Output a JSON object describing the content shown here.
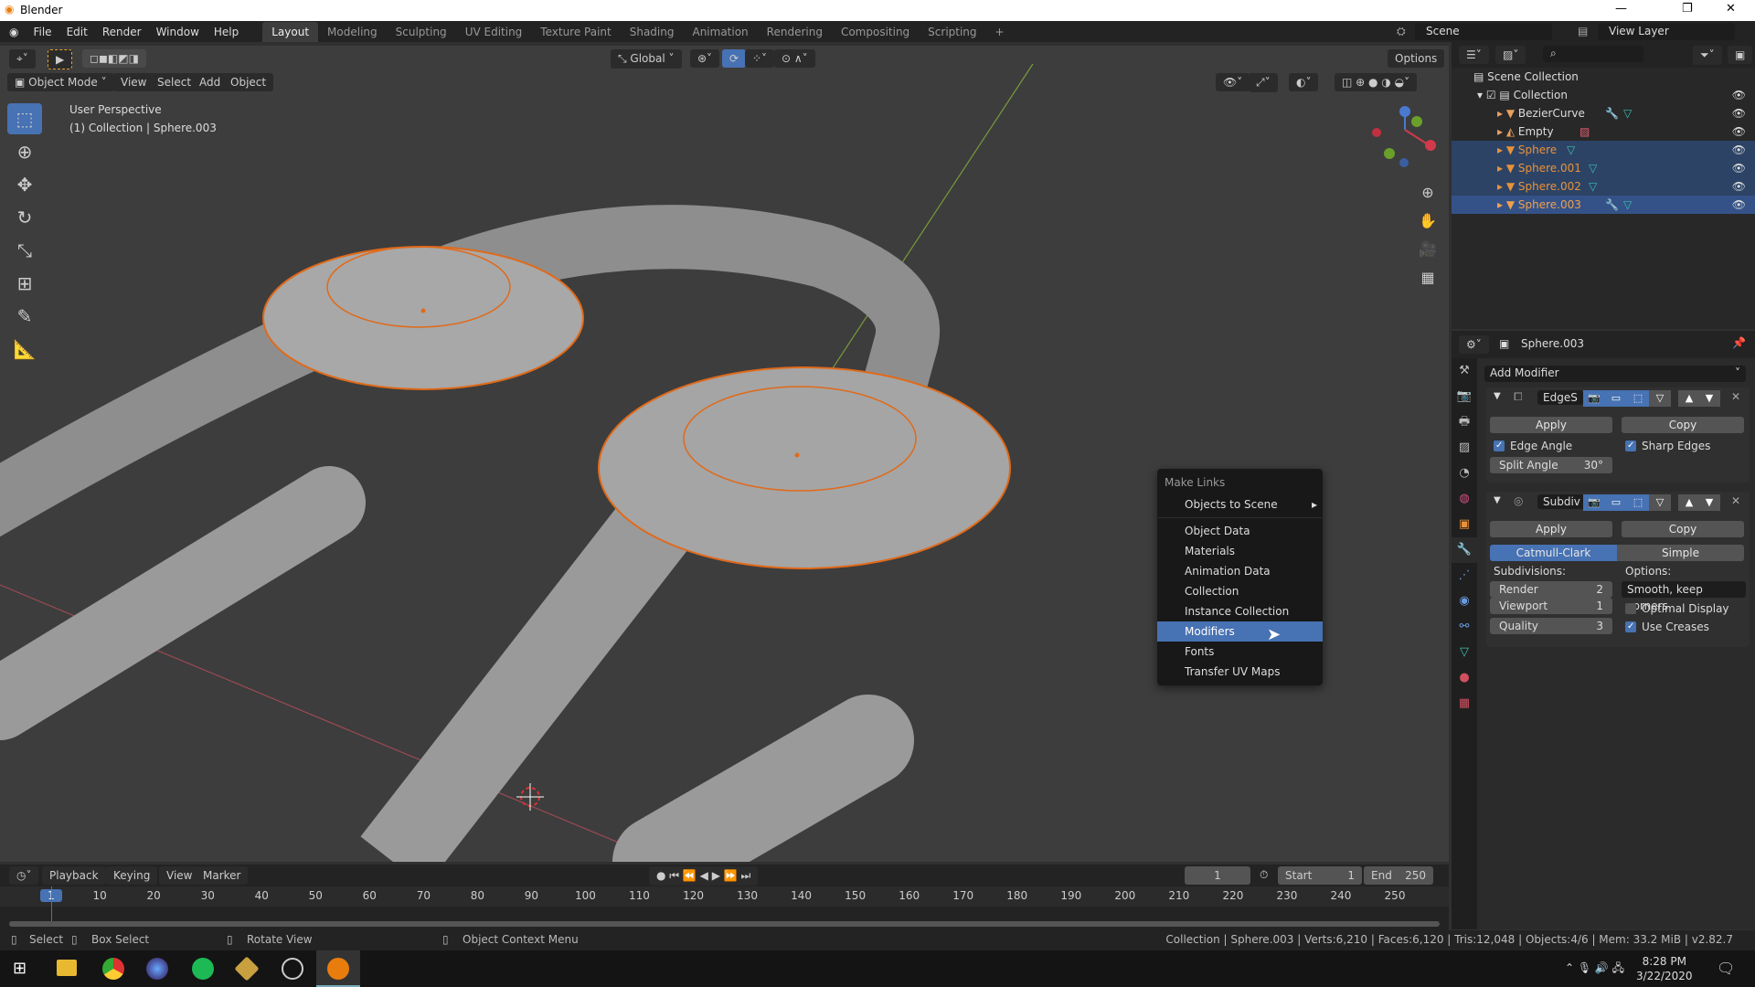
{
  "window": {
    "title": "Blender",
    "controls": [
      "—",
      "❐",
      "✕"
    ]
  },
  "menubar": {
    "items": [
      "File",
      "Edit",
      "Render",
      "Window",
      "Help"
    ]
  },
  "workspaces": [
    "Layout",
    "Modeling",
    "Sculpting",
    "UV Editing",
    "Texture Paint",
    "Shading",
    "Animation",
    "Rendering",
    "Compositing",
    "Scripting"
  ],
  "workspace_add": "+",
  "scene": {
    "label": "Scene",
    "view_layer": "View Layer"
  },
  "tool_header": {
    "orientation": "Global",
    "options": "Options"
  },
  "viewport_header": {
    "mode": "Object Mode",
    "menus": [
      "View",
      "Select",
      "Add",
      "Object"
    ]
  },
  "viewport": {
    "perspective": "User Perspective",
    "context": "(1) Collection | Sphere.003"
  },
  "context_menu": {
    "title": "Make Links",
    "items": [
      "Objects to Scene",
      "Object Data",
      "Materials",
      "Animation Data",
      "Collection",
      "Instance Collection",
      "Modifiers",
      "Fonts",
      "Transfer UV Maps"
    ],
    "selected": "Modifiers",
    "submenu_arrow": "▸"
  },
  "outliner": {
    "root": "Scene Collection",
    "collection": "Collection",
    "items": [
      {
        "name": "BezierCurve",
        "state": ""
      },
      {
        "name": "Empty",
        "state": ""
      },
      {
        "name": "Sphere",
        "state": "selected"
      },
      {
        "name": "Sphere.001",
        "state": "selected"
      },
      {
        "name": "Sphere.002",
        "state": "selected"
      },
      {
        "name": "Sphere.003",
        "state": "active"
      }
    ]
  },
  "properties": {
    "object": "Sphere.003",
    "add_modifier": "Add Modifier",
    "mod1": {
      "name": "EdgeS",
      "apply": "Apply",
      "copy": "Copy",
      "edge_angle": "Edge Angle",
      "sharp_edges": "Sharp Edges",
      "split_angle_label": "Split Angle",
      "split_angle": "30°"
    },
    "mod2": {
      "name": "Subdiv",
      "apply": "Apply",
      "copy": "Copy",
      "catmull": "Catmull-Clark",
      "simple": "Simple",
      "subdivisions": "Subdivisions:",
      "options": "Options:",
      "render_label": "Render",
      "render": "2",
      "viewport_label": "Viewport",
      "viewport": "1",
      "quality_label": "Quality",
      "quality": "3",
      "uv_smooth": "Smooth, keep corners",
      "optimal_display": "Optimal Display",
      "use_creases": "Use Creases"
    }
  },
  "timeline": {
    "menus": [
      "Playback",
      "Keying",
      "View",
      "Marker"
    ],
    "current_frame": "1",
    "start_label": "Start",
    "start": "1",
    "end_label": "End",
    "end": "250",
    "ticks": [
      "1",
      "10",
      "20",
      "30",
      "40",
      "50",
      "60",
      "70",
      "80",
      "90",
      "100",
      "110",
      "120",
      "130",
      "140",
      "150",
      "160",
      "170",
      "180",
      "190",
      "200",
      "210",
      "220",
      "230",
      "240",
      "250"
    ]
  },
  "statusbar": {
    "select": "Select",
    "box_select": "Box Select",
    "rotate": "Rotate View",
    "context_menu": "Object Context Menu",
    "stats": "Collection | Sphere.003 | Verts:6,210 | Faces:6,120 | Tris:12,048 | Objects:4/6 | Mem: 33.2 MiB | v2.82.7"
  },
  "taskbar": {
    "time": "8:28 PM",
    "date": "3/22/2020"
  }
}
